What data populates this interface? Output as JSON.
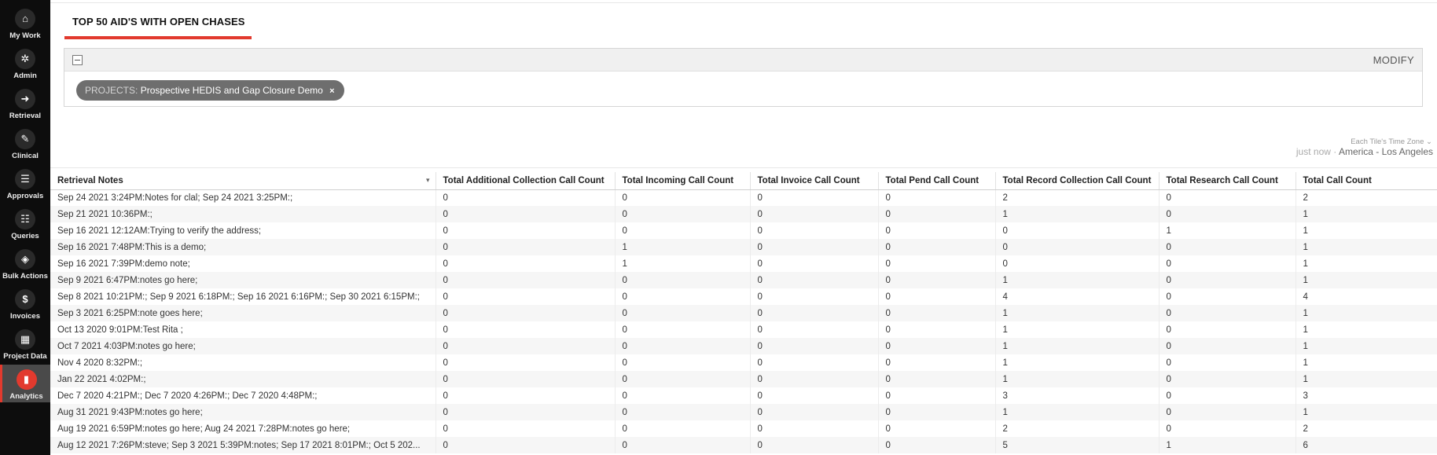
{
  "nav": [
    {
      "label": "My Work",
      "icon": "home-icon",
      "glyph": "⌂"
    },
    {
      "label": "Admin",
      "icon": "gear-icon",
      "glyph": "✲"
    },
    {
      "label": "Retrieval",
      "icon": "arrow-in-icon",
      "glyph": "➜"
    },
    {
      "label": "Clinical",
      "icon": "clipboard-icon",
      "glyph": "✎"
    },
    {
      "label": "Approvals",
      "icon": "list-icon",
      "glyph": "☰"
    },
    {
      "label": "Queries",
      "icon": "query-icon",
      "glyph": "☷"
    },
    {
      "label": "Bulk Actions",
      "icon": "layers-icon",
      "glyph": "◈"
    },
    {
      "label": "Invoices",
      "icon": "dollar-icon",
      "glyph": "$"
    },
    {
      "label": "Project Data",
      "icon": "grid-icon",
      "glyph": "▦"
    },
    {
      "label": "Analytics",
      "icon": "bar-chart-icon",
      "glyph": "▮"
    }
  ],
  "header": {
    "title": "TOP 50 AID'S WITH OPEN CHASES"
  },
  "filter": {
    "modify_label": "MODIFY",
    "chip_key": "PROJECTS:",
    "chip_value": "Prospective HEDIS and Gap Closure Demo",
    "chip_remove": "×"
  },
  "timezone": {
    "label": "Each Tile's Time Zone",
    "refreshed": "just now",
    "separator": "·",
    "zone": "America - Los Angeles"
  },
  "table": {
    "columns": [
      "Retrieval Notes",
      "Total Additional Collection Call Count",
      "Total Incoming Call Count",
      "Total Invoice Call Count",
      "Total Pend Call Count",
      "Total Record Collection Call Count",
      "Total Research Call Count",
      "Total Call Count"
    ],
    "rows": [
      [
        "Sep 24 2021 3:24PM:Notes for clal; Sep 24 2021 3:25PM:;",
        "0",
        "0",
        "0",
        "0",
        "2",
        "0",
        "2"
      ],
      [
        "Sep 21 2021 10:36PM:;",
        "0",
        "0",
        "0",
        "0",
        "1",
        "0",
        "1"
      ],
      [
        "Sep 16 2021 12:12AM:Trying to verify the address;",
        "0",
        "0",
        "0",
        "0",
        "0",
        "1",
        "1"
      ],
      [
        "Sep 16 2021 7:48PM:This is a demo;",
        "0",
        "1",
        "0",
        "0",
        "0",
        "0",
        "1"
      ],
      [
        "Sep 16 2021 7:39PM:demo note;",
        "0",
        "1",
        "0",
        "0",
        "0",
        "0",
        "1"
      ],
      [
        "Sep 9 2021 6:47PM:notes go here;",
        "0",
        "0",
        "0",
        "0",
        "1",
        "0",
        "1"
      ],
      [
        "Sep 8 2021 10:21PM:; Sep 9 2021 6:18PM:; Sep 16 2021 6:16PM:; Sep 30 2021 6:15PM:;",
        "0",
        "0",
        "0",
        "0",
        "4",
        "0",
        "4"
      ],
      [
        "Sep 3 2021 6:25PM:note goes here;",
        "0",
        "0",
        "0",
        "0",
        "1",
        "0",
        "1"
      ],
      [
        "Oct 13 2020 9:01PM:Test Rita ;",
        "0",
        "0",
        "0",
        "0",
        "1",
        "0",
        "1"
      ],
      [
        "Oct 7 2021 4:03PM:notes go here;",
        "0",
        "0",
        "0",
        "0",
        "1",
        "0",
        "1"
      ],
      [
        "Nov 4 2020 8:32PM:;",
        "0",
        "0",
        "0",
        "0",
        "1",
        "0",
        "1"
      ],
      [
        "Jan 22 2021 4:02PM:;",
        "0",
        "0",
        "0",
        "0",
        "1",
        "0",
        "1"
      ],
      [
        "Dec 7 2020 4:21PM:; Dec 7 2020 4:26PM:; Dec 7 2020 4:48PM:;",
        "0",
        "0",
        "0",
        "0",
        "3",
        "0",
        "3"
      ],
      [
        "Aug 31 2021 9:43PM:notes go here;",
        "0",
        "0",
        "0",
        "0",
        "1",
        "0",
        "1"
      ],
      [
        "Aug 19 2021 6:59PM:notes go here; Aug 24 2021 7:28PM:notes go here;",
        "0",
        "0",
        "0",
        "0",
        "2",
        "0",
        "2"
      ],
      [
        "Aug 12 2021 7:26PM:steve; Sep 3 2021 5:39PM:notes; Sep 17 2021 8:01PM:; Oct 5 202...",
        "0",
        "0",
        "0",
        "0",
        "5",
        "1",
        "6"
      ]
    ]
  },
  "colors": {
    "accent": "#e23a2e",
    "sidebar": "#0d0d0d",
    "chip": "#6e6e6e"
  }
}
